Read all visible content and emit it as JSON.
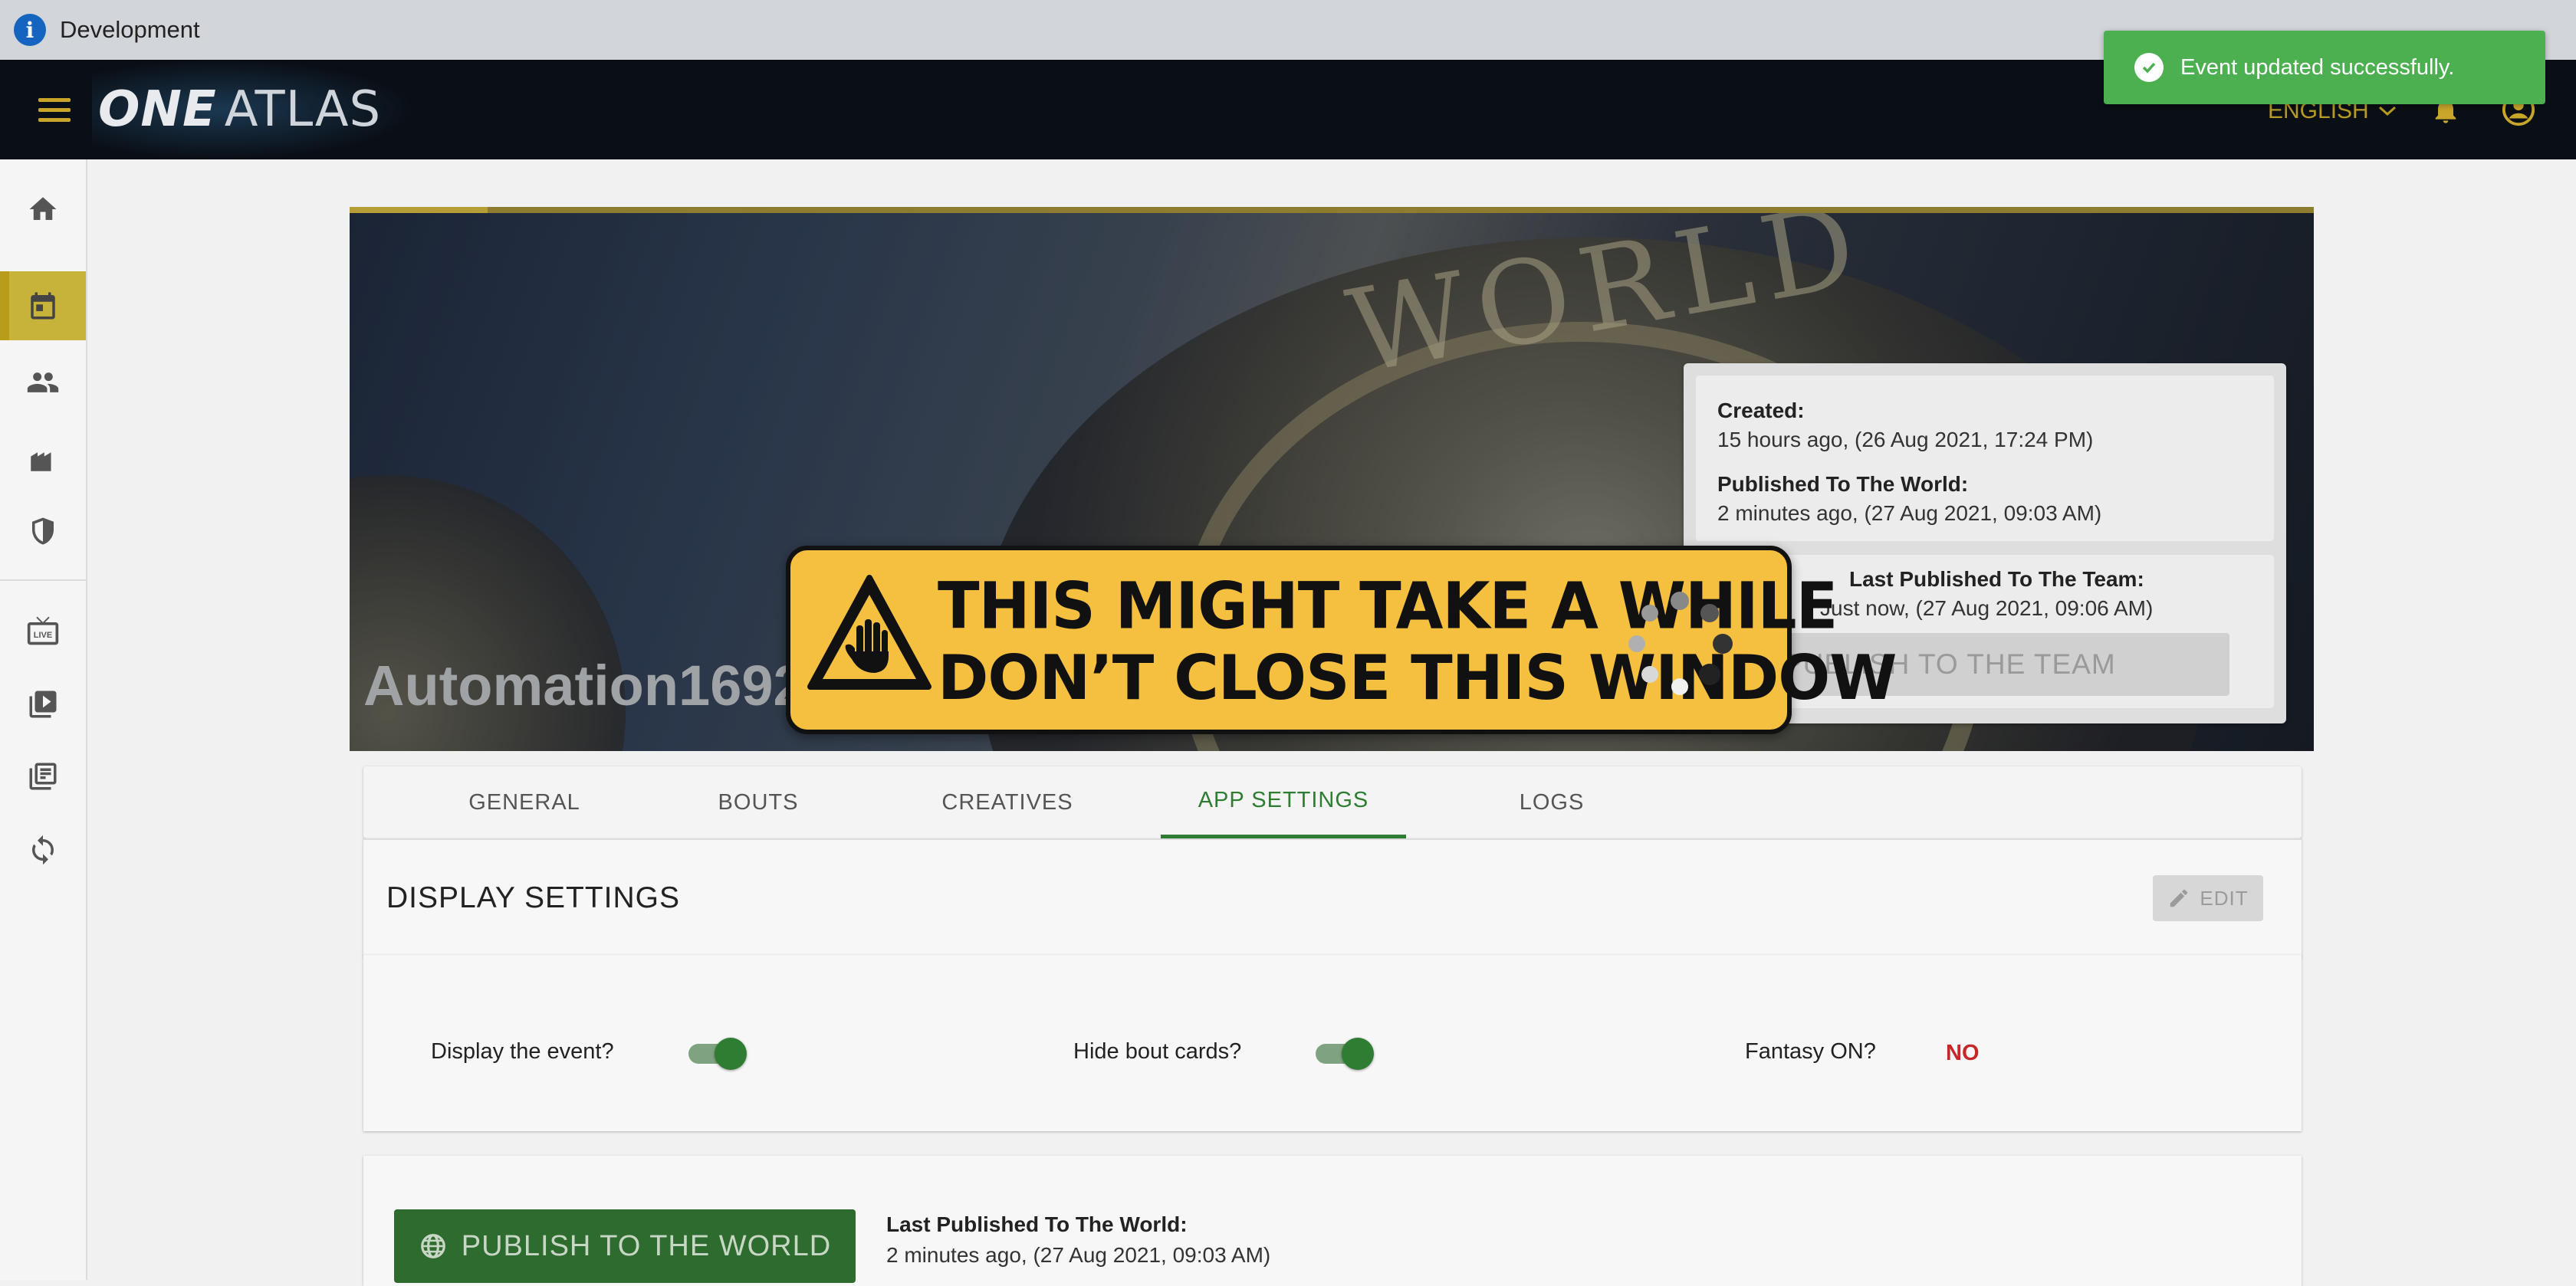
{
  "env_bar": {
    "label": "Development",
    "info_icon": "i"
  },
  "topbar": {
    "logo_bold": "ONE",
    "logo_light": "ATLAS",
    "language": "ENGLISH"
  },
  "toast": {
    "message": "Event updated successfully."
  },
  "event": {
    "title": "Automation1692 2"
  },
  "dates": {
    "created_label": "Created:",
    "created_value": "15 hours ago, (26 Aug 2021, 17:24 PM)",
    "world_label": "Published To The World:",
    "world_value": "2 minutes ago, (27 Aug 2021, 09:03 AM)",
    "team_label": "Last Published To The Team:",
    "team_value": "Just now, (27 Aug 2021, 09:06 AM)",
    "publish_team_label": "PUBLISH TO THE TEAM"
  },
  "loading_modal": {
    "line1": "THIS MIGHT TAKE A WHILE",
    "line2": "DON’T CLOSE THIS WINDOW"
  },
  "tabs": [
    {
      "label": "GENERAL"
    },
    {
      "label": "BOUTS"
    },
    {
      "label": "CREATIVES"
    },
    {
      "label": "APP SETTINGS"
    },
    {
      "label": "LOGS"
    }
  ],
  "active_tab": "APP SETTINGS",
  "display_settings": {
    "heading": "DISPLAY SETTINGS",
    "edit_label": "EDIT",
    "display_event_label": "Display the event?",
    "display_event_on": true,
    "hide_bout_label": "Hide bout cards?",
    "hide_bout_on": true,
    "fantasy_label": "Fantasy ON?",
    "fantasy_value": "NO"
  },
  "publish_world": {
    "button_label": "PUBLISH TO THE WORLD",
    "last_label": "Last Published To The World:",
    "last_value": "2 minutes ago, (27 Aug 2021, 09:03 AM)"
  },
  "colors": {
    "accent_green": "#2e7d32",
    "toast_green": "#4caf50",
    "warning_yellow": "#f5c040",
    "alert_red": "#c62828"
  },
  "icons": [
    "info-icon",
    "menu-icon",
    "chevron-down-icon",
    "bell-icon",
    "account-icon",
    "home-icon",
    "calendar-icon",
    "people-icon",
    "venue-icon",
    "shield-icon",
    "live-tv-icon",
    "video-library-icon",
    "collections-icon",
    "sync-icon",
    "check-circle-icon",
    "upload-icon",
    "hand-stop-icon",
    "spinner-icon",
    "pencil-icon",
    "globe-icon"
  ]
}
